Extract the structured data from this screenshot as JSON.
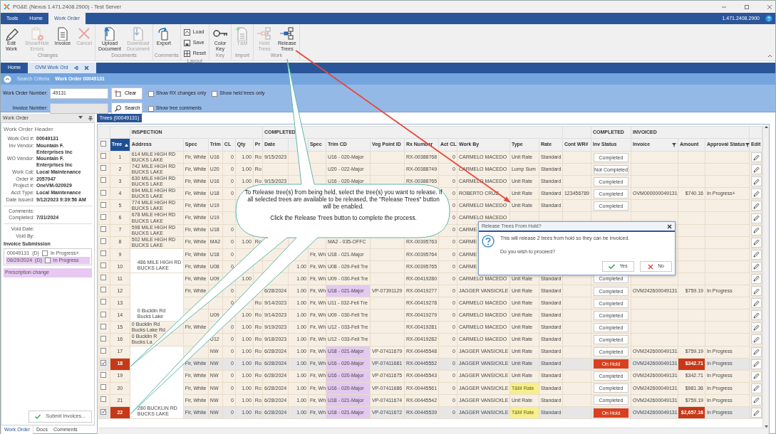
{
  "window": {
    "title": "PG&E (Nexus 1.471.2408.2900) - Test Server"
  },
  "ribbon_tabs": [
    {
      "label": "Tools",
      "selected": false
    },
    {
      "label": "Home",
      "selected": false
    },
    {
      "label": "Work Order",
      "selected": true
    }
  ],
  "version": "1.471.2408.2900",
  "ribbon_groups": [
    {
      "label": "Changes",
      "buttons": [
        {
          "kind": "large",
          "lines": [
            "Edit",
            "Work"
          ],
          "disabled": false
        },
        {
          "kind": "large",
          "lines": [
            "Show/Hide",
            "Errors"
          ],
          "disabled": true
        },
        {
          "kind": "large",
          "lines": [
            "Invoice"
          ],
          "disabled": false
        },
        {
          "kind": "large",
          "lines": [
            "Cancel"
          ],
          "disabled": true
        }
      ]
    },
    {
      "label": "Documents",
      "buttons": [
        {
          "kind": "large",
          "lines": [
            "Upload",
            "Document"
          ],
          "disabled": false
        },
        {
          "kind": "large",
          "lines": [
            "Download",
            "Document"
          ],
          "disabled": true
        }
      ]
    },
    {
      "label": "Comments",
      "buttons": [
        {
          "kind": "large",
          "lines": [
            "Export"
          ],
          "disabled": false
        }
      ]
    },
    {
      "label": "Layout",
      "buttons": [
        {
          "kind": "small",
          "lines": [
            "Load"
          ],
          "disabled": false
        },
        {
          "kind": "small",
          "lines": [
            "Save"
          ],
          "disabled": false
        },
        {
          "kind": "small",
          "lines": [
            "Reset"
          ],
          "disabled": false
        }
      ]
    },
    {
      "label": "Key",
      "buttons": [
        {
          "kind": "large",
          "lines": [
            "Color",
            "Key"
          ],
          "disabled": false
        }
      ]
    },
    {
      "label": "Import",
      "buttons": [
        {
          "kind": "large",
          "lines": [
            "T&M"
          ],
          "disabled": true
        }
      ]
    },
    {
      "label": "Work",
      "buttons": [
        {
          "kind": "large",
          "lines": [
            "Hold",
            "Trees"
          ],
          "disabled": true
        },
        {
          "kind": "large",
          "lines": [
            "Release",
            "Trees"
          ],
          "disabled": false
        }
      ]
    }
  ],
  "doc_tabs": [
    {
      "label": "Home",
      "selected": false
    },
    {
      "label": "OVM Work Ord",
      "selected": true
    }
  ],
  "search": {
    "title": "Search Criteria",
    "heading": "Work Order 00049131",
    "rows": [
      {
        "label": "Work Order Number:",
        "value": "49131",
        "disabled": false,
        "button": "Clear",
        "checkboxes": [
          {
            "label": "Show RX changes only",
            "checked": false
          },
          {
            "label": "Show held trees only",
            "checked": false
          }
        ]
      },
      {
        "label": "Invoice Number:",
        "disabled": true,
        "button": "Search",
        "checkboxes": [
          {
            "label": "Show tree comments",
            "checked": false
          }
        ]
      }
    ]
  },
  "panel": {
    "title": "Work Order",
    "header": "Work Order Header",
    "field_groups": [
      [
        {
          "label": "Work Ord #:",
          "value": "00049131"
        },
        {
          "label": "Inv Vendor:",
          "value": "Mountain F. Enterprises Inc"
        },
        {
          "label": "WO Vendor:",
          "value": "Mountain F. Enterprises Inc"
        },
        {
          "label": "Work Cat:",
          "value": "Local Maintenance"
        },
        {
          "label": "Order #:",
          "value": "2057047"
        },
        {
          "label": "Project #:",
          "value": "OneVM-020929"
        },
        {
          "label": "Acct Type:",
          "value": "Local Maintenance"
        },
        {
          "label": "Date Issued:",
          "value": "9/12/2023 9:39:56 AM"
        }
      ],
      [
        {
          "label": "Comments:"
        },
        {
          "label": "Completed:",
          "value": "7/31/2024"
        }
      ],
      [
        {
          "label": "Void Date:"
        },
        {
          "label": "Void By:"
        }
      ]
    ],
    "invoice_label": "Invoice Submission",
    "invoices": [
      {
        "number": "00049131",
        "code": "(D)",
        "checked": false,
        "status": "In Progress+",
        "selected": false
      },
      {
        "number": "06/29/2024",
        "code": "(D)",
        "checked": false,
        "status": "In Progress",
        "selected": true
      }
    ],
    "note": "Prescription change",
    "submit": "Submit Invoices...",
    "tabs": [
      {
        "label": "Work Order",
        "selected": true
      },
      {
        "label": "Docs",
        "selected": false
      },
      {
        "label": "Comments",
        "selected": false
      }
    ]
  },
  "grid": {
    "tab": "Trees (00049131)",
    "select_all": {
      "checked": false
    },
    "column_groups": [
      {
        "columns": [
          {
            "label": "Tree",
            "sorted": true
          }
        ]
      },
      {
        "label": "INSPECTION",
        "columns": [
          {
            "label": "Address"
          },
          {
            "label": "Spec"
          },
          {
            "label": "Trim"
          },
          {
            "label": "CL"
          },
          {
            "label": "Qty"
          },
          {
            "label": "Pr"
          }
        ]
      },
      {
        "label": "COMPLETED",
        "columns": [
          {
            "label": "Date"
          },
          {},
          {
            "label": "Spec"
          },
          {
            "label": "Trim CD"
          },
          {
            "label": "Veg Point ID"
          },
          {
            "label": "Rx Number"
          },
          {
            "label": "Act CL"
          },
          {
            "label": "Work By"
          },
          {
            "label": "Type"
          },
          {
            "label": "Rate"
          }
        ]
      },
      {
        "columns": [
          {
            "label": "Cont WR#"
          }
        ]
      },
      {
        "label": "COMPLETED",
        "columns": [
          {
            "label": "Inv Status"
          }
        ]
      },
      {
        "label": "INVOICED",
        "columns": [
          {
            "label": "Invoice",
            "filtered": true
          },
          {
            "label": "Amount"
          },
          {
            "label": "Approval Status",
            "filtered": true
          }
        ]
      },
      {
        "columns": [
          {
            "label": "Edit"
          }
        ]
      }
    ],
    "groups": [
      {
        "address": [
          "614 MILE HIGH RD",
          "BUCKS LAKE"
        ],
        "rows": [
          {
            "tree": "1",
            "selected": false,
            "on_hold": false,
            "trim_flag": false,
            "type_flag": false,
            "cells": [
              "Fir, White",
              "U16",
              "0",
              "1.00",
              "Ro",
              "9/15/2023",
              null,
              null,
              "U16 - 020-Major",
              null,
              "RX-00388768",
              "0",
              "CARMELO MACEDO",
              "Unit Rate",
              "Standard",
              null,
              "Completed",
              null,
              null,
              null
            ]
          }
        ]
      },
      {
        "address": [
          "742 MILE HIGH RD",
          "BUCKS LAKE"
        ],
        "rows": [
          {
            "tree": "2",
            "selected": false,
            "on_hold": false,
            "trim_flag": false,
            "type_flag": false,
            "cells": [
              "Fir, White",
              "U20",
              "0",
              "1.00",
              "Ro",
              null,
              null,
              null,
              "U20 - 022-Major",
              null,
              "RX-00388749",
              "0",
              "CARMELO MACEDO",
              "Lump Sum",
              "Standard",
              null,
              "Not Completed",
              null,
              null,
              null
            ]
          }
        ]
      },
      {
        "address": [
          "630 MILE HIGH RD",
          "BUCKS LAKE"
        ],
        "rows": [
          {
            "tree": "3",
            "selected": false,
            "on_hold": false,
            "trim_flag": false,
            "type_flag": false,
            "cells": [
              "Fir, White",
              "U16",
              "0",
              "1.00",
              "Ro",
              "9/15/2023",
              null,
              null,
              "U16 - 020-Major",
              null,
              "RX-00388765",
              "0",
              "CARMELO MACEDO",
              "Unit Rate",
              "Standard",
              null,
              "Completed",
              null,
              null,
              null
            ]
          }
        ]
      },
      {
        "address": [
          "694 MILE HIGH RD",
          "BUCKS LAKE"
        ],
        "rows": [
          {
            "tree": "4",
            "selected": false,
            "on_hold": false,
            "trim_flag": false,
            "type_flag": false,
            "cells": [
              "Fir, White",
              "U18",
              "0",
              null,
              null,
              null,
              null,
              null,
              null,
              null,
              null,
              "0",
              "ROBERTO CRUZ",
              "Unit Rate",
              "Standard",
              "123456789",
              "Completed",
              "OVM000000049131",
              "$740.16",
              "In Progress+"
            ]
          }
        ]
      },
      {
        "address": [
          "774 MILE HIGH RD",
          "BUCKS LAKE"
        ],
        "rows": [
          {
            "tree": "5",
            "selected": false,
            "on_hold": false,
            "trim_flag": false,
            "type_flag": false,
            "cells": [
              "Fir, White",
              "U19",
              null,
              null,
              null,
              null,
              null,
              null,
              null,
              null,
              null,
              "0",
              "CARMELO MACEDO",
              "Unit Rate",
              "Standard",
              null,
              "Completed",
              null,
              null,
              null
            ]
          }
        ]
      },
      {
        "address": [
          "678 MILE HIGH RD",
          "BUCKS LAKE"
        ],
        "rows": [
          {
            "tree": "6",
            "selected": false,
            "on_hold": false,
            "trim_flag": false,
            "type_flag": false,
            "cells": [
              "Fir, White",
              "U19",
              null,
              null,
              null,
              null,
              null,
              null,
              null,
              null,
              null,
              "0",
              "CARMELO MACEDO",
              null,
              null,
              null,
              null,
              null,
              null,
              null
            ]
          }
        ]
      },
      {
        "address": [
          "598 MILE HIGH RD",
          "BUCKS LAKE"
        ],
        "rows": [
          {
            "tree": "7",
            "selected": false,
            "on_hold": false,
            "trim_flag": false,
            "type_flag": false,
            "cells": [
              "Fir, White",
              "U18",
              "0",
              null,
              null,
              null,
              null,
              null,
              null,
              null,
              null,
              "0",
              "CARME",
              null,
              null,
              null,
              null,
              null,
              null,
              null
            ]
          }
        ]
      },
      {
        "address": [
          "502 MILE HIGH RD",
          "BUCKS LAKE"
        ],
        "rows": [
          {
            "tree": "8",
            "selected": false,
            "on_hold": false,
            "trim_flag": false,
            "type_flag": false,
            "cells": [
              "Fir, White",
              "MA2",
              "0",
              "1.00",
              "Ro",
              null,
              null,
              null,
              "MA2 - 035-OFFC",
              null,
              "RX-00395763",
              "0",
              "CARME",
              null,
              null,
              null,
              null,
              null,
              null,
              null
            ]
          }
        ]
      },
      {
        "address": [
          "486 MILE HIGH RD",
          "BUCKS LAKE"
        ],
        "rows": [
          {
            "tree": "9",
            "selected": false,
            "on_hold": false,
            "trim_flag": false,
            "type_flag": false,
            "cells": [
              "Fir, White",
              "U18",
              "0",
              null,
              null,
              null,
              null,
              "Fir, Wh",
              "U18 - 021-Major",
              null,
              "RX-00395764",
              "0",
              "CARME",
              null,
              null,
              null,
              null,
              null,
              null,
              null
            ]
          },
          {
            "tree": "10",
            "selected": false,
            "on_hold": false,
            "trim_flag": false,
            "type_flag": false,
            "cells": [
              "Fir, White",
              "U08",
              "0",
              null,
              null,
              null,
              "1.00",
              "Fir, Wh",
              "U08 - 029-Fell Tre",
              null,
              "RX-00395765",
              "0",
              "CARME",
              null,
              null,
              null,
              null,
              null,
              null,
              null
            ]
          }
        ]
      },
      {
        "address": [
          "0 Bucklin Rd",
          "Bucks Lake"
        ],
        "rows": [
          {
            "tree": "11",
            "selected": false,
            "on_hold": false,
            "trim_flag": false,
            "type_flag": false,
            "cells": [
              "Fir, White",
              "U09",
              null,
              "1.00",
              null,
              null,
              "1.00",
              "Fir, Wh",
              "U09 - 030-Fell Tre",
              null,
              "RX-00419280",
              "0",
              "CARMELO MACEDO",
              "Unit Rate",
              "Standard",
              null,
              "Completed",
              null,
              null,
              null
            ]
          },
          {
            "tree": "12",
            "selected": false,
            "on_hold": false,
            "trim_flag": true,
            "type_flag": false,
            "cells": [
              "Fir, White",
              null,
              "0",
              null,
              null,
              "6/28/2024",
              "1.00",
              "Fir, Wh",
              "U18 - 021-Major",
              "VP-07391129",
              "RX-00419277",
              "0",
              "JAGGER VANSICKLE",
              "Unit Rate",
              "Standard",
              null,
              "Completed",
              "OVM242600049131",
              "$759.19",
              "In Progress"
            ]
          },
          {
            "tree": "13",
            "selected": false,
            "on_hold": false,
            "trim_flag": false,
            "type_flag": false,
            "cells": [
              null,
              null,
              "0",
              null,
              "Ro",
              "9/14/2023",
              "1.00",
              "Fir, Wh",
              "U11 - 032-Fell Tre",
              null,
              "RX-00419278",
              "0",
              "CARMELO MACEDO",
              "Unit Rate",
              "Standard",
              null,
              "Completed",
              null,
              null,
              null
            ]
          },
          {
            "tree": "14",
            "selected": false,
            "on_hold": false,
            "trim_flag": false,
            "type_flag": false,
            "cells": [
              null,
              "U09",
              null,
              "1.00",
              "Ro",
              "9/14/2023",
              "1.00",
              "Fir, Wh",
              "U09 - 030-Fell Tre",
              null,
              "RX-00419279",
              "0",
              "CARMELO MACEDO",
              "Unit Rate",
              "Standard",
              null,
              "Completed",
              null,
              null,
              null
            ]
          }
        ]
      },
      {
        "address": [
          "0 Bucklin Rd",
          "Bucks Lake Rd"
        ],
        "rows": [
          {
            "tree": "15",
            "selected": false,
            "on_hold": false,
            "trim_flag": false,
            "type_flag": false,
            "cells": [
              "Fir, White",
              null,
              "0",
              "1.00",
              "Ro",
              "9/19/2023",
              "1.00",
              "Fir, Wh",
              "U12 - 033-Fell Tre",
              null,
              "RX-00419281",
              "0",
              "CARMELO MACEDO",
              "Unit Rate",
              "Standard",
              null,
              "Completed",
              null,
              null,
              null
            ]
          }
        ]
      },
      {
        "address": [
          "0 Bucklin R",
          "Bucks La"
        ],
        "rows": [
          {
            "tree": "16",
            "selected": false,
            "on_hold": false,
            "trim_flag": false,
            "type_flag": false,
            "cells": [
              null,
              "U12",
              "0",
              "1.00",
              "Ro",
              "9/18/2023",
              "1.00",
              "Fir, Wh",
              "U12 - 033-Fell Tre",
              null,
              "RX-00419282",
              "0",
              "CARMELO MACEDO",
              "Unit Rate",
              "Standard",
              null,
              "Completed",
              null,
              null,
              null
            ]
          }
        ]
      },
      {
        "address": [
          "280 BUCKLIN RD",
          "BUCKS LAKE"
        ],
        "rows": [
          {
            "tree": "17",
            "selected": false,
            "on_hold": false,
            "trim_flag": true,
            "type_flag": false,
            "cells": [
              null,
              "NW",
              "0",
              "1.00",
              "Ro",
              "6/28/2024",
              "1.00",
              "Fir, Wh",
              "U18 - 021-Major",
              "VP-07411679",
              "RX-00445548",
              "0",
              "JAGGER VANSICKLE",
              "Unit Rate",
              "Standard",
              null,
              "Completed",
              "OVM242600049131",
              "$759.19",
              "In Progress"
            ]
          },
          {
            "tree": "18",
            "selected": true,
            "on_hold": true,
            "trim_flag": true,
            "type_flag": false,
            "cells": [
              "Fir, White",
              "NW",
              "0",
              "1.00",
              "Ro",
              "6/28/2024",
              "1.00",
              "Fir, Wh",
              "U16 - 020-Major",
              "VP-07411681",
              "RX-00445552",
              "0",
              "JAGGER VANSICKLE",
              "Unit Rate",
              "Standard",
              null,
              "On Hold",
              "OVM242600049131",
              "$342.71",
              "In Progress"
            ]
          },
          {
            "tree": "19",
            "selected": false,
            "on_hold": false,
            "trim_flag": true,
            "type_flag": false,
            "cells": [
              "Fir, White",
              "NW",
              "0",
              "1.00",
              "Ro",
              "6/28/2024",
              "1.00",
              "Fir, Wh",
              "U16 - 020-Major",
              "VP-07411675",
              "RX-00445543",
              "0",
              "JAGGER VANSICKLE",
              "Unit Rate",
              "Standard",
              null,
              "Completed",
              "OVM242600049131",
              "$342.71",
              "In Progress"
            ]
          },
          {
            "tree": "20",
            "selected": false,
            "on_hold": false,
            "trim_flag": true,
            "type_flag": true,
            "cells": [
              "Fir, White",
              "NW",
              "0",
              "1.00",
              "Ro",
              "6/28/2024",
              "1.00",
              "Fir, Wh",
              "U16 - 020-Major",
              "VP-07411686",
              "RX-00445561",
              "0",
              "JAGGER VANSICKLE",
              "T&M Rate",
              "Standard",
              null,
              "Completed",
              "OVM242600049131",
              "$981.36",
              "In Progress"
            ]
          },
          {
            "tree": "21",
            "selected": false,
            "on_hold": false,
            "trim_flag": true,
            "type_flag": false,
            "cells": [
              "Fir, White",
              "NW",
              "0",
              "1.00",
              "Ro",
              "6/28/2024",
              "1.00",
              "Fir, Wh",
              "U18 - 021-Major",
              "VP-07411674",
              "RX-00445542",
              "0",
              "JAGGER VANSICKLE",
              "Unit Rate",
              "Standard",
              null,
              "Completed",
              "OVM242600049131",
              "$759.19",
              "In Progress"
            ]
          },
          {
            "tree": "22",
            "selected": true,
            "on_hold": true,
            "trim_flag": true,
            "type_flag": true,
            "cells": [
              "Fir, White",
              "NW",
              "0",
              "1.00",
              "Ro",
              "6/28/2024",
              "1.00",
              "Fir, Wh",
              "U18 - 021-Major",
              "VP-07411672",
              "RX-00445539",
              "0",
              "JAGGER VANSICKLE",
              "T&M Rate",
              "Standard",
              null,
              "On Hold",
              "OVM242600049131",
              "$2,657.16",
              "In Progress"
            ]
          }
        ]
      }
    ]
  },
  "callout": {
    "paragraphs": [
      "To Release tree(s) from being held, select the tree(s) you want to release.  If all selected trees are available to be released, the \"Release Trees\" button will be enabled.",
      "Click the Release Trees button to complete the process."
    ]
  },
  "dialog": {
    "title": "Release Trees From Hold?",
    "message": "This will release 2 trees from hold so they can be invoiced.",
    "question": "Do you wish to proceed?",
    "buttons": [
      "Yes",
      "No"
    ]
  }
}
